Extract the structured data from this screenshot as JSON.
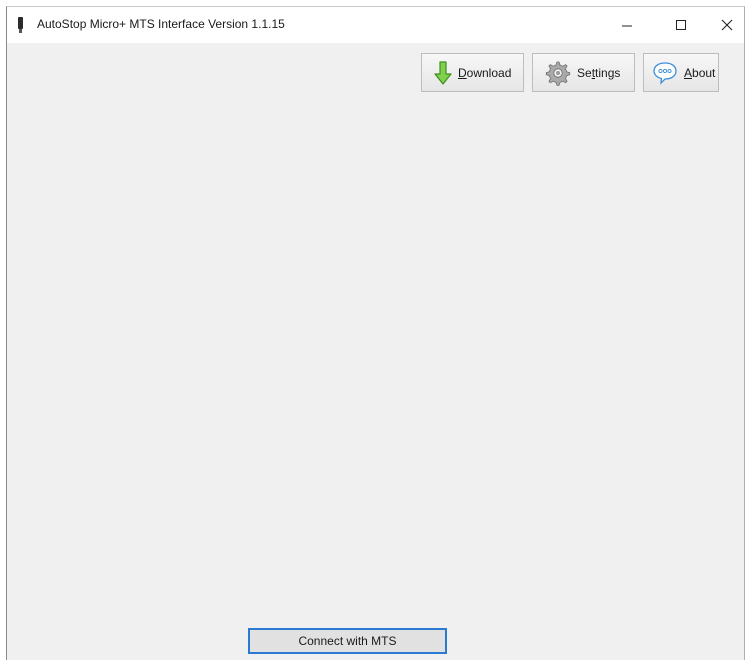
{
  "window": {
    "title": "AutoStop Micro+ MTS Interface Version 1.1.15",
    "icons": {
      "app": "device-icon",
      "minimize": "minimize-icon",
      "maximize": "maximize-icon",
      "close": "close-icon"
    }
  },
  "toolbar": {
    "download": {
      "accel": "D",
      "rest": "ownload",
      "icon": "down-arrow-icon"
    },
    "settings": {
      "before": "Se",
      "accel": "t",
      "rest": "tings",
      "icon": "gear-icon"
    },
    "about": {
      "accel": "A",
      "rest": "bout",
      "icon": "speech-bubble-icon"
    }
  },
  "footer": {
    "connect_label": "Connect with MTS"
  },
  "colors": {
    "accent": "#2a7ad4",
    "window_bg": "#f0f0f0",
    "download_arrow": "#5cb82e"
  }
}
